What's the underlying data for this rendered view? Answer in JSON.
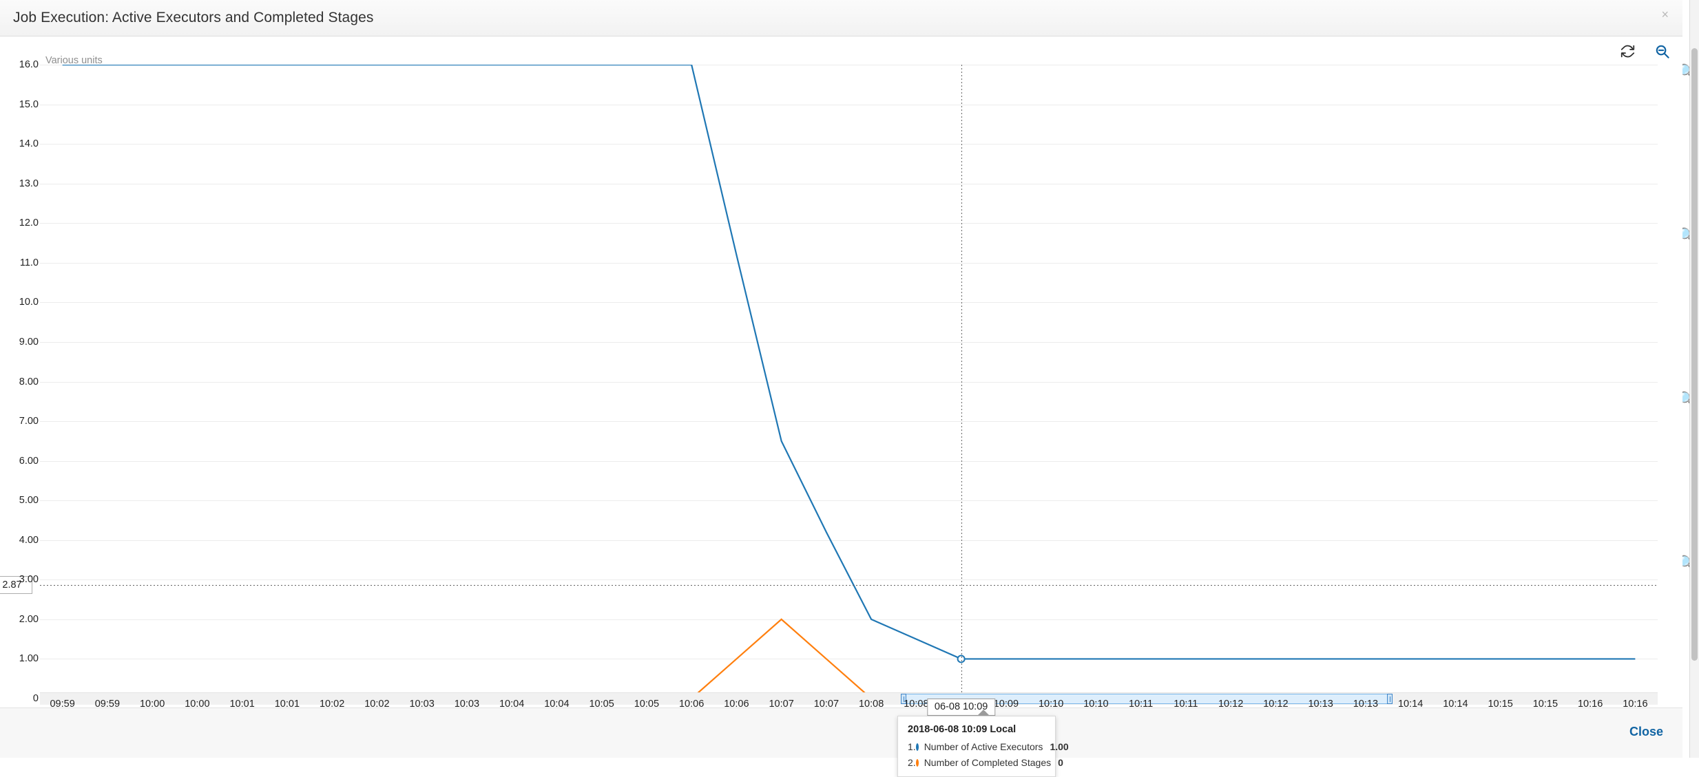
{
  "window": {
    "title": "Job Execution: Active Executors and Completed Stages",
    "close_x": "×",
    "close_button": "Close"
  },
  "toolbar": {
    "refresh_icon": "refresh-icon",
    "zoom_out_icon": "zoom-out-icon"
  },
  "chart_data": {
    "type": "line",
    "title": "Job Execution: Active Executors and Completed Stages",
    "ylabel": "Various units",
    "xlabel": "",
    "ylim": [
      0,
      16
    ],
    "grid": true,
    "legend_position": "bottom-left",
    "ytick_labels": [
      "16.0",
      "15.0",
      "14.0",
      "13.0",
      "12.0",
      "11.0",
      "10.0",
      "9.00",
      "8.00",
      "7.00",
      "6.00",
      "5.00",
      "4.00",
      "3.00",
      "2.00",
      "1.00",
      "0"
    ],
    "ytick_values": [
      16,
      15,
      14,
      13,
      12,
      11,
      10,
      9,
      8,
      7,
      6,
      5,
      4,
      3,
      2,
      1,
      0
    ],
    "xtick_labels": [
      "09:59",
      "09:59",
      "10:00",
      "10:00",
      "10:01",
      "10:01",
      "10:02",
      "10:02",
      "10:03",
      "10:03",
      "10:04",
      "10:04",
      "10:05",
      "10:05",
      "10:06",
      "10:06",
      "10:07",
      "10:07",
      "10:08",
      "10:08",
      "10:09",
      "10:09",
      "10:10",
      "10:10",
      "10:11",
      "10:11",
      "10:12",
      "10:12",
      "10:13",
      "10:13",
      "10:14",
      "10:14",
      "10:15",
      "10:15",
      "10:16",
      "10:16"
    ],
    "x": [
      0,
      1,
      2,
      3,
      4,
      5,
      6,
      7,
      8,
      9,
      10,
      11,
      12,
      13,
      14,
      15,
      16,
      17,
      18,
      19,
      20,
      21,
      22,
      23,
      24,
      25,
      26,
      27,
      28,
      29,
      30,
      31,
      32,
      33,
      34,
      35
    ],
    "series": [
      {
        "name": "Number of Active Executors",
        "color": "#1f77b4",
        "values": [
          16,
          16,
          16,
          16,
          16,
          16,
          16,
          16,
          16,
          16,
          16,
          16,
          16,
          16,
          16,
          11.2,
          6.5,
          4.2,
          2.0,
          1.5,
          1.0,
          1.0,
          1.0,
          1.0,
          1.0,
          1.0,
          1.0,
          1.0,
          1.0,
          1.0,
          1.0,
          1.0,
          1.0,
          1.0,
          1.0,
          1.0
        ]
      },
      {
        "name": "Number of Completed Stages",
        "color": "#ff7f0e",
        "values": [
          0,
          0,
          0,
          0,
          0,
          0,
          0,
          0,
          0,
          0,
          0,
          0,
          0,
          0,
          0,
          1.0,
          2.0,
          1.0,
          0,
          0,
          0,
          0,
          0,
          0,
          0,
          0,
          0,
          0,
          0,
          0,
          0,
          0,
          0,
          0,
          0,
          0
        ]
      }
    ],
    "cursor": {
      "x_label": "06-08 10:09",
      "y_value_label": "2.87"
    }
  },
  "tooltip": {
    "title": "2018-06-08 10:09 Local",
    "rows": [
      {
        "index": "1.",
        "name": "Number of Active Executors",
        "value": "1.00",
        "color": "#1f77b4"
      },
      {
        "index": "2.",
        "name": "Number of Completed Stages",
        "value": "0",
        "color": "#ff7f0e"
      }
    ]
  }
}
